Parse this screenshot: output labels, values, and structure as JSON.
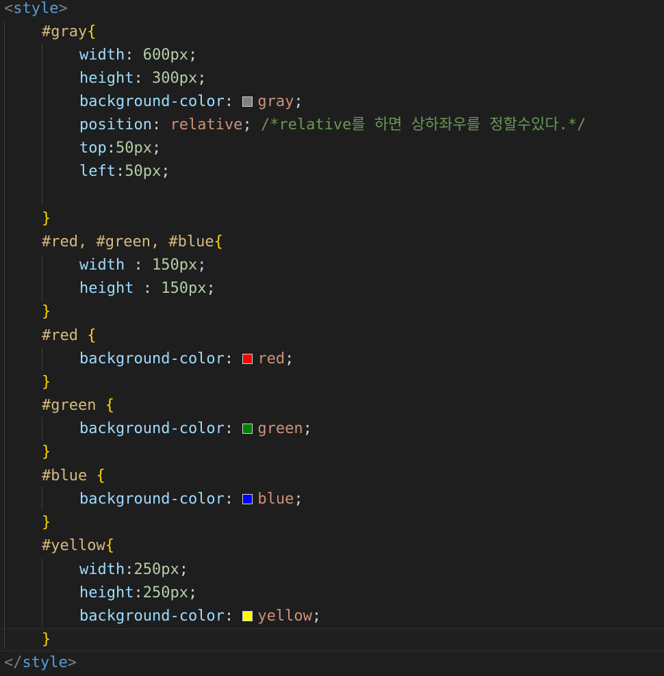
{
  "code": {
    "open_tag": "style",
    "close_tag": "style",
    "gray_rule": {
      "selector": "#gray",
      "width_prop": "width",
      "width_val": "600px",
      "height_prop": "height",
      "height_val": "300px",
      "bg_prop": "background-color",
      "bg_val": "gray",
      "position_prop": "position",
      "position_val": "relative",
      "comment": "/*relative를 하면 상하좌우를 정할수있다.*/",
      "top_prop": "top",
      "top_val": "50px",
      "left_prop": "left",
      "left_val": "50px"
    },
    "rgb_rule": {
      "selector": "#red, #green, #blue",
      "width_prop": "width",
      "width_val": "150px",
      "height_prop": "height",
      "height_val": "150px"
    },
    "red_rule": {
      "selector": "#red",
      "bg_prop": "background-color",
      "bg_val": "red"
    },
    "green_rule": {
      "selector": "#green",
      "bg_prop": "background-color",
      "bg_val": "green"
    },
    "blue_rule": {
      "selector": "#blue",
      "bg_prop": "background-color",
      "bg_val": "blue"
    },
    "yellow_rule": {
      "selector": "#yellow",
      "width_prop": "width",
      "width_val": "250px",
      "height_prop": "height",
      "height_val": "250px",
      "bg_prop": "background-color",
      "bg_val": "yellow"
    }
  },
  "swatch_colors": {
    "gray": "#808080",
    "red": "#ff0000",
    "green": "#008000",
    "blue": "#0000ff",
    "yellow": "#ffff00"
  }
}
